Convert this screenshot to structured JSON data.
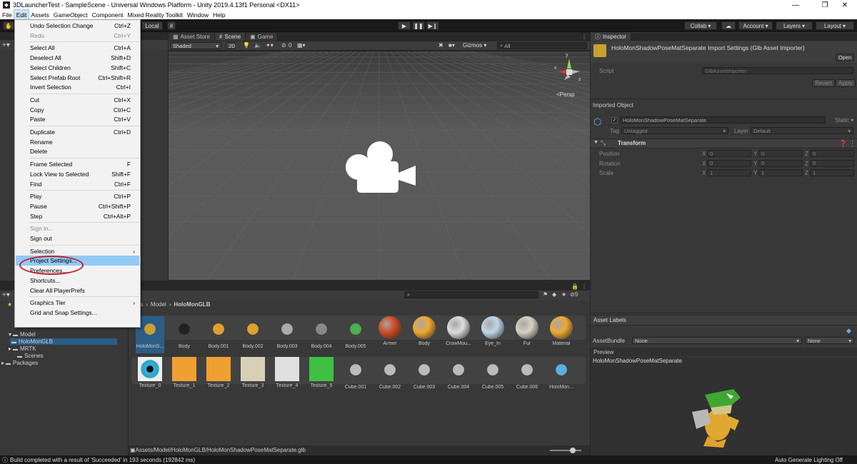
{
  "window": {
    "title": "3DLauncherTest - SampleScene - Universal Windows Platform - Unity 2019.4.13f1 Personal <DX11>"
  },
  "menubar": [
    "File",
    "Edit",
    "Assets",
    "GameObject",
    "Component",
    "Mixed Reality Toolkit",
    "Window",
    "Help"
  ],
  "toolbar": {
    "local": "Local",
    "collab": "Collab",
    "account": "Account",
    "layers": "Layers",
    "layout": "Layout"
  },
  "tabs": {
    "asset_store": "Asset Store",
    "scene": "Scene",
    "game": "Game",
    "inspector": "Inspector"
  },
  "scene_toolbar": {
    "shading": "Shaded",
    "mode_2d": "2D",
    "count": "0",
    "gizmos": "Gizmos",
    "search_placeholder": "All",
    "persp": "<Persp"
  },
  "gizmo": {
    "x": "x",
    "y": "y",
    "z": "z"
  },
  "edit_menu": [
    {
      "label": "Undo Selection Change",
      "sc": "Ctrl+Z"
    },
    {
      "label": "Redo",
      "sc": "Ctrl+Y",
      "dis": true
    },
    {
      "label": "Select All",
      "sc": "Ctrl+A"
    },
    {
      "label": "Deselect All",
      "sc": "Shift+D"
    },
    {
      "label": "Select Children",
      "sc": "Shift+C"
    },
    {
      "label": "Select Prefab Root",
      "sc": "Ctrl+Shift+R"
    },
    {
      "label": "Invert Selection",
      "sc": "Ctrl+I"
    },
    {
      "label": "Cut",
      "sc": "Ctrl+X"
    },
    {
      "label": "Copy",
      "sc": "Ctrl+C"
    },
    {
      "label": "Paste",
      "sc": "Ctrl+V"
    },
    {
      "label": "Duplicate",
      "sc": "Ctrl+D"
    },
    {
      "label": "Rename",
      "sc": ""
    },
    {
      "label": "Delete",
      "sc": ""
    },
    {
      "label": "Frame Selected",
      "sc": "F"
    },
    {
      "label": "Lock View to Selected",
      "sc": "Shift+F"
    },
    {
      "label": "Find",
      "sc": "Ctrl+F"
    },
    {
      "label": "Play",
      "sc": "Ctrl+P"
    },
    {
      "label": "Pause",
      "sc": "Ctrl+Shift+P"
    },
    {
      "label": "Step",
      "sc": "Ctrl+Alt+P"
    },
    {
      "label": "Sign in...",
      "sc": "",
      "dis": true
    },
    {
      "label": "Sign out",
      "sc": ""
    },
    {
      "label": "Selection",
      "sc": "",
      "sub": true
    },
    {
      "label": "Project Settings...",
      "sc": "",
      "hl": true
    },
    {
      "label": "Preferences...",
      "sc": ""
    },
    {
      "label": "Shortcuts...",
      "sc": ""
    },
    {
      "label": "Clear All PlayerPrefs",
      "sc": ""
    },
    {
      "label": "Graphics Tier",
      "sc": "",
      "sub": true
    },
    {
      "label": "Grid and Snap Settings...",
      "sc": ""
    }
  ],
  "inspector": {
    "asset_title": "HoloMonShadowPoseMatSeparate Import Settings (Glb Asset Importer)",
    "open": "Open",
    "script_label": "Script",
    "script_value": "GlbAssetImporter",
    "revert": "Revert",
    "apply": "Apply",
    "imported_object": "Imported Object",
    "object_name": "HoloMonShadowPoseMatSeparate",
    "static": "Static",
    "tag_label": "Tag",
    "tag_value": "Untagged",
    "layer_label": "Layer",
    "layer_value": "Default",
    "transform": "Transform",
    "rows": [
      {
        "label": "Position",
        "x": "0",
        "y": "0",
        "z": "0"
      },
      {
        "label": "Rotation",
        "x": "0",
        "y": "0",
        "z": "0"
      },
      {
        "label": "Scale",
        "x": "1",
        "y": "1",
        "z": "1"
      }
    ],
    "asset_labels": "Asset Labels",
    "asset_bundle_label": "AssetBundle",
    "asset_bundle_value": "None",
    "asset_bundle_variant": "None",
    "preview": "Preview",
    "preview_name": "HoloMonShadowPoseMatSeparate"
  },
  "project": {
    "breadcrumb": [
      "ts",
      "Model",
      "HoloMonGLB"
    ],
    "slider_count": "9",
    "row1": [
      {
        "name": "HoloMonS...",
        "color": "#c8a030"
      },
      {
        "name": "Body",
        "color": "#222"
      },
      {
        "name": "Body.001",
        "color": "#e0a030"
      },
      {
        "name": "Body.002",
        "color": "#e0a030"
      },
      {
        "name": "Body.003",
        "color": "#aaaaaa"
      },
      {
        "name": "Body.004",
        "color": "#888"
      },
      {
        "name": "Body.005",
        "color": "#4caf50"
      },
      {
        "name": "Armer",
        "color": "#d04a20"
      },
      {
        "name": "Body",
        "color": "#f0a830"
      },
      {
        "name": "CrowMou...",
        "color": "#dddddd"
      },
      {
        "name": "Eye_In",
        "color": "#bfd8e8"
      },
      {
        "name": "Fur",
        "color": "#d8d0c0"
      },
      {
        "name": "Material",
        "color": "#f0a830"
      }
    ],
    "row2": [
      {
        "name": "Texture_0",
        "color": "#2aa0c8"
      },
      {
        "name": "Texture_1",
        "color": "#f0a030"
      },
      {
        "name": "Texture_2",
        "color": "#f0a030"
      },
      {
        "name": "Texture_3",
        "color": "#d8cfb8"
      },
      {
        "name": "Texture_4",
        "color": "#e0e0e0"
      },
      {
        "name": "Texture_5",
        "color": "#40c040"
      },
      {
        "name": "Cube.001",
        "color": "#bbb"
      },
      {
        "name": "Cube.002",
        "color": "#bbb"
      },
      {
        "name": "Cube.003",
        "color": "#bbb"
      },
      {
        "name": "Cube.004",
        "color": "#bbb"
      },
      {
        "name": "Cube.005",
        "color": "#bbb"
      },
      {
        "name": "Cube.006",
        "color": "#bbb"
      },
      {
        "name": "HoloMon...",
        "color": "#5aaee0"
      }
    ],
    "path": "Assets/Model/HoloMonGLB/HoloMonShadowPoseMatSeparate.glb"
  },
  "tree": [
    "Model",
    "HoloMonGLB",
    "MRTK",
    "Scenes",
    "Packages"
  ],
  "status": {
    "message": "Build completed with a result of 'Succeeded' in 193 seconds (192842 ms)",
    "right": "Auto Generate Lighting Off"
  }
}
